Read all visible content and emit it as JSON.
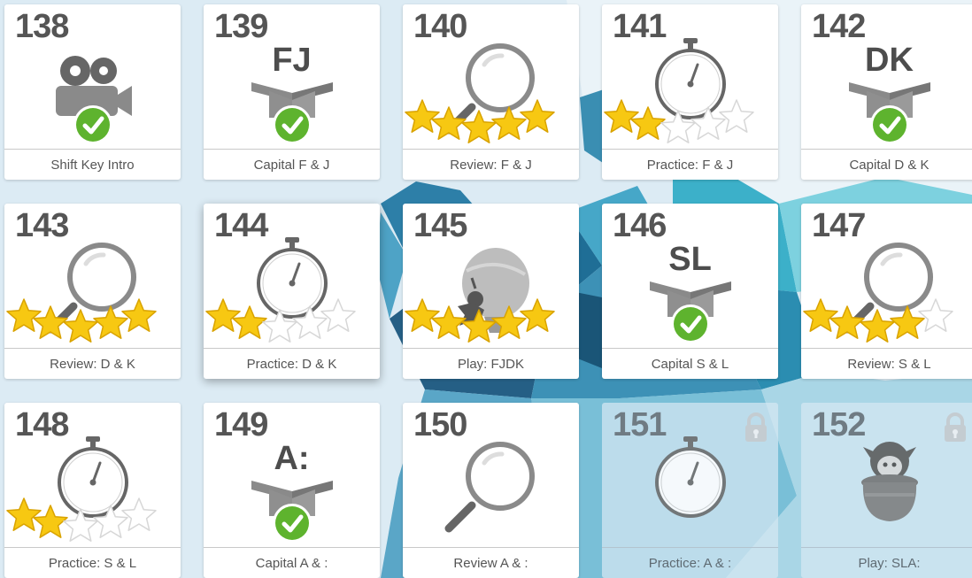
{
  "colors": {
    "icon_gray": "#8a8a8a",
    "icon_dark": "#666666",
    "check_green": "#5eb32e",
    "star_gold": "#f7c812",
    "star_empty": "#ffffff",
    "lock_gray": "#c4ccd1"
  },
  "lessons": [
    {
      "number": "138",
      "label": "Shift Key Intro",
      "icon": "video-camera-icon",
      "status": "completed",
      "stars": null,
      "letters": ""
    },
    {
      "number": "139",
      "label": "Capital F & J",
      "icon": "letter-box-icon",
      "status": "completed",
      "stars": null,
      "letters": "FJ"
    },
    {
      "number": "140",
      "label": "Review: F & J",
      "icon": "magnifier-icon",
      "status": "rated",
      "stars": 5,
      "letters": ""
    },
    {
      "number": "141",
      "label": "Practice: F & J",
      "icon": "stopwatch-icon",
      "status": "rated",
      "stars": 2,
      "letters": ""
    },
    {
      "number": "142",
      "label": "Capital D & K",
      "icon": "letter-box-icon",
      "status": "completed",
      "stars": null,
      "letters": "DK"
    },
    {
      "number": "143",
      "label": "Review: D & K",
      "icon": "magnifier-icon",
      "status": "rated",
      "stars": 5,
      "letters": ""
    },
    {
      "number": "144",
      "label": "Practice: D & K",
      "icon": "stopwatch-icon",
      "status": "rated",
      "stars": 2,
      "letters": ""
    },
    {
      "number": "145",
      "label": "Play: FJDK",
      "icon": "balloon-game-icon",
      "status": "rated",
      "stars": 5,
      "letters": ""
    },
    {
      "number": "146",
      "label": "Capital S & L",
      "icon": "letter-box-icon",
      "status": "completed",
      "stars": null,
      "letters": "SL"
    },
    {
      "number": "147",
      "label": "Review: S & L",
      "icon": "magnifier-icon",
      "status": "rated",
      "stars": 4,
      "letters": ""
    },
    {
      "number": "148",
      "label": "Practice: S & L",
      "icon": "stopwatch-icon",
      "status": "rated",
      "stars": 2,
      "letters": ""
    },
    {
      "number": "149",
      "label": "Capital A & :",
      "icon": "letter-box-icon",
      "status": "completed",
      "stars": null,
      "letters": "A:"
    },
    {
      "number": "150",
      "label": "Review A & :",
      "icon": "magnifier-icon",
      "status": "available",
      "stars": null,
      "letters": ""
    },
    {
      "number": "151",
      "label": "Practice: A & :",
      "icon": "stopwatch-icon",
      "status": "locked",
      "stars": null,
      "letters": ""
    },
    {
      "number": "152",
      "label": "Play: SLA:",
      "icon": "pot-character-icon",
      "status": "locked",
      "stars": null,
      "letters": ""
    }
  ]
}
